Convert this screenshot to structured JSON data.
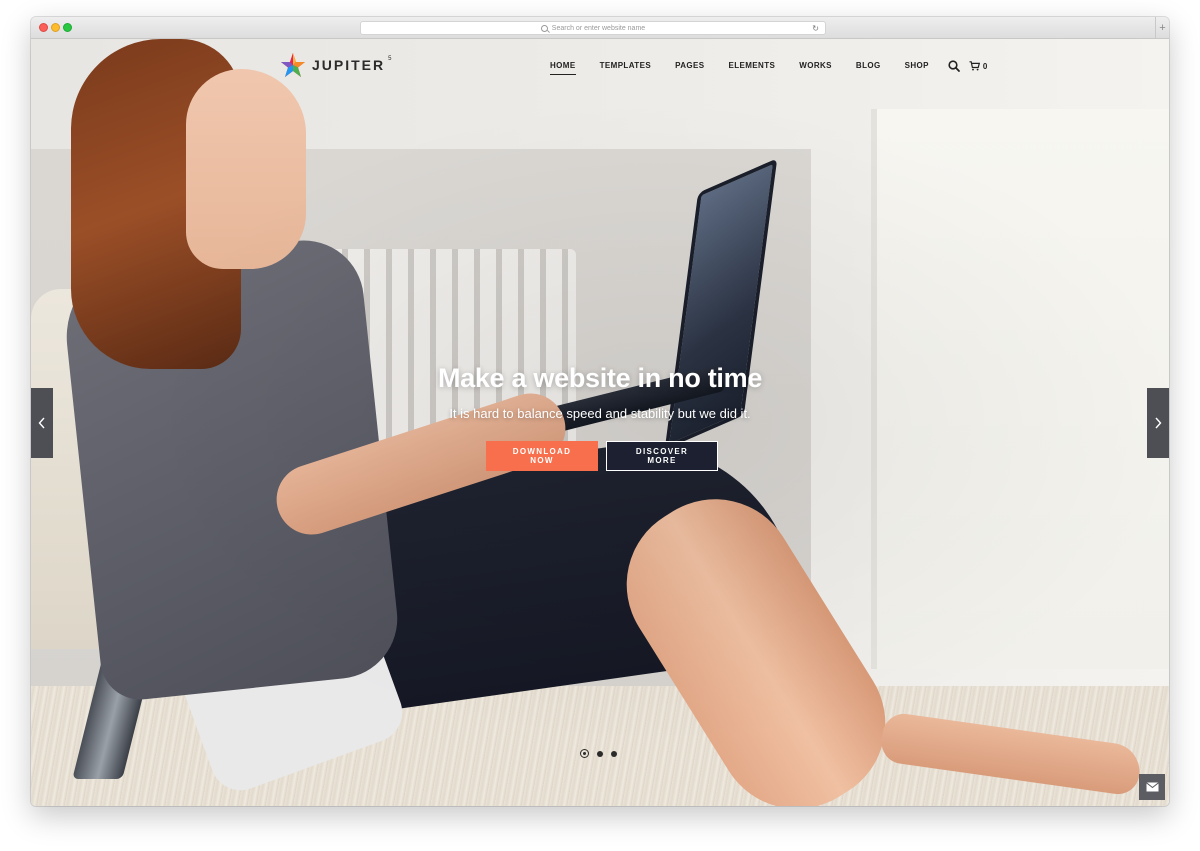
{
  "browser": {
    "url_placeholder": "Search or enter website name",
    "newtab_label": "+"
  },
  "header": {
    "logo_text": "JUPITER",
    "logo_superscript": "5",
    "nav": [
      {
        "label": "HOME",
        "active": true
      },
      {
        "label": "TEMPLATES"
      },
      {
        "label": "PAGES"
      },
      {
        "label": "ELEMENTS"
      },
      {
        "label": "WORKS"
      },
      {
        "label": "BLOG"
      },
      {
        "label": "SHOP"
      }
    ],
    "cart_count": "0",
    "icons": {
      "search": "search-icon",
      "cart": "cart-icon"
    }
  },
  "hero": {
    "title": "Make a website in no time",
    "subtitle": "It is hard to balance speed and stability but we did it.",
    "primary_button": "DOWNLOAD NOW",
    "secondary_button": "DISCOVER MORE",
    "slides_total": 3,
    "active_slide": 1
  },
  "colors": {
    "accent": "#f76f4c",
    "dark_button": "#1c2030",
    "arrow_bg": "#4d4f55"
  }
}
